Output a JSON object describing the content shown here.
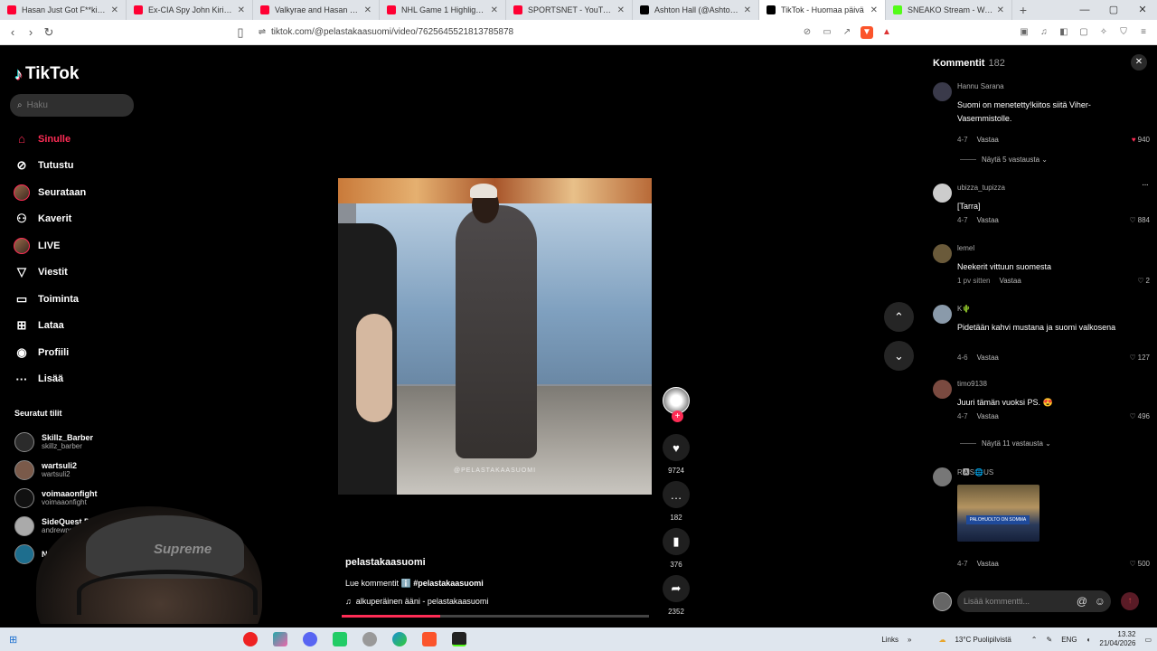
{
  "browser": {
    "tabs": [
      {
        "title": "Hasan Just Got F**king Humilia",
        "color": "#ff0033"
      },
      {
        "title": "Ex-CIA Spy John Kiriakou on fa",
        "color": "#ff0033"
      },
      {
        "title": "Valkyrae and Hasan Relationsh",
        "color": "#ff0033"
      },
      {
        "title": "NHL Game 1 Highlights | Duck",
        "color": "#ff0033"
      },
      {
        "title": "SPORTSNET - YouTube",
        "color": "#ff0033"
      },
      {
        "title": "Ashton Hall (@AshtonHallofc)",
        "color": "#000000"
      },
      {
        "title": "TikTok - Huomaa päivä",
        "color": "#000000",
        "active": true
      },
      {
        "title": "SNEAKO Stream - Watch Live",
        "color": "#53fc18"
      }
    ],
    "url": "tiktok.com/@pelastakaasuomi/video/7625645521813785878"
  },
  "sidebar": {
    "logo": "TikTok",
    "search_placeholder": "Haku",
    "nav": [
      {
        "label": "Sinulle",
        "icon": "home-icon",
        "glyph": "⌂"
      },
      {
        "label": "Tutustu",
        "icon": "compass-icon",
        "glyph": "⊘"
      },
      {
        "label": "Seurataan",
        "icon": "following-avatar-icon",
        "glyph": ""
      },
      {
        "label": "Kaverit",
        "icon": "friends-icon",
        "glyph": "⚇"
      },
      {
        "label": "LIVE",
        "icon": "live-avatar-icon",
        "glyph": ""
      },
      {
        "label": "Viestit",
        "icon": "messages-icon",
        "glyph": "▽"
      },
      {
        "label": "Toiminta",
        "icon": "activity-icon",
        "glyph": "▭"
      },
      {
        "label": "Lataa",
        "icon": "upload-icon",
        "glyph": "⊞"
      },
      {
        "label": "Profiili",
        "icon": "profile-icon",
        "glyph": "◉"
      },
      {
        "label": "Lisää",
        "icon": "more-icon",
        "glyph": "···"
      }
    ],
    "followed_title": "Seuratut tilit",
    "followed": [
      {
        "name": "Skillz_Barber",
        "handle": "skillz_barber",
        "color": "#2b2b2b"
      },
      {
        "name": "wartsuli2",
        "handle": "wartsuli2",
        "color": "#7a5a4a"
      },
      {
        "name": "voimaaonfight",
        "handle": "voimaaonfight",
        "color": "#111111"
      },
      {
        "name": "SideQuest Drew",
        "handle": "andrewprotiv",
        "color": "#aaaaaa"
      },
      {
        "name": "Nuku Lahtinen",
        "handle": "",
        "color": "#1e6e8e"
      }
    ],
    "cam_text": "Supreme"
  },
  "video": {
    "watermark": "@PELASTAKAASUOMI",
    "author": "pelastakaasuomi",
    "caption_prefix": "Lue kommentit ℹ️",
    "caption_tag": "#pelastakaasuomi",
    "sound": "alkuperäinen ääni - pelastakaasuomi",
    "progress": 0.32
  },
  "actions": {
    "likes": "9724",
    "comments": "182",
    "saves": "376",
    "shares": "2352"
  },
  "comments": {
    "title": "Kommentit",
    "count": "182",
    "items": [
      {
        "user": "Hannu Sarana",
        "text": "Suomi on menetetty!kiitos siitä Viher-Vasemmistolle.",
        "date": "4-7",
        "likes": "940",
        "liked": true,
        "avatar": "#3a3a4a"
      },
      {
        "user": "ubizza_tupizza",
        "text": "[Tarra]",
        "date": "4-7",
        "likes": "884",
        "liked": false,
        "avatar": "#cccccc"
      },
      {
        "user": "lemel",
        "text": "Neekerit vittuun suomesta",
        "date": "1 pv sitten",
        "likes": "2",
        "liked": false,
        "avatar": "#6a5a3a"
      },
      {
        "user": "K🌵",
        "text": "Pidetään kahvi mustana ja suomi valkosena",
        "date": "4-6",
        "likes": "127",
        "liked": false,
        "avatar": "#8a9aaa"
      },
      {
        "user": "timo9138",
        "text": "Juuri tämän vuoksi PS. 😍",
        "date": "4-7",
        "likes": "496",
        "liked": false,
        "avatar": "#7a4a40"
      },
      {
        "user": "R🅰S🌐US",
        "text": "",
        "date": "4-7",
        "likes": "500",
        "liked": false,
        "avatar": "#777777"
      }
    ],
    "reply": "Vastaa",
    "more_1": "Näytä 5 vastausta",
    "more_2": "Näytä 11 vastausta",
    "image_banner": "PALOHUOLTO ON SOMMA",
    "input_placeholder": "Lisää kommentti..."
  },
  "taskbar": {
    "links": "Links",
    "weather": "13°C  Puolipilvistä",
    "lang": "ENG",
    "time": "13.32",
    "date": "21/04/2026"
  }
}
